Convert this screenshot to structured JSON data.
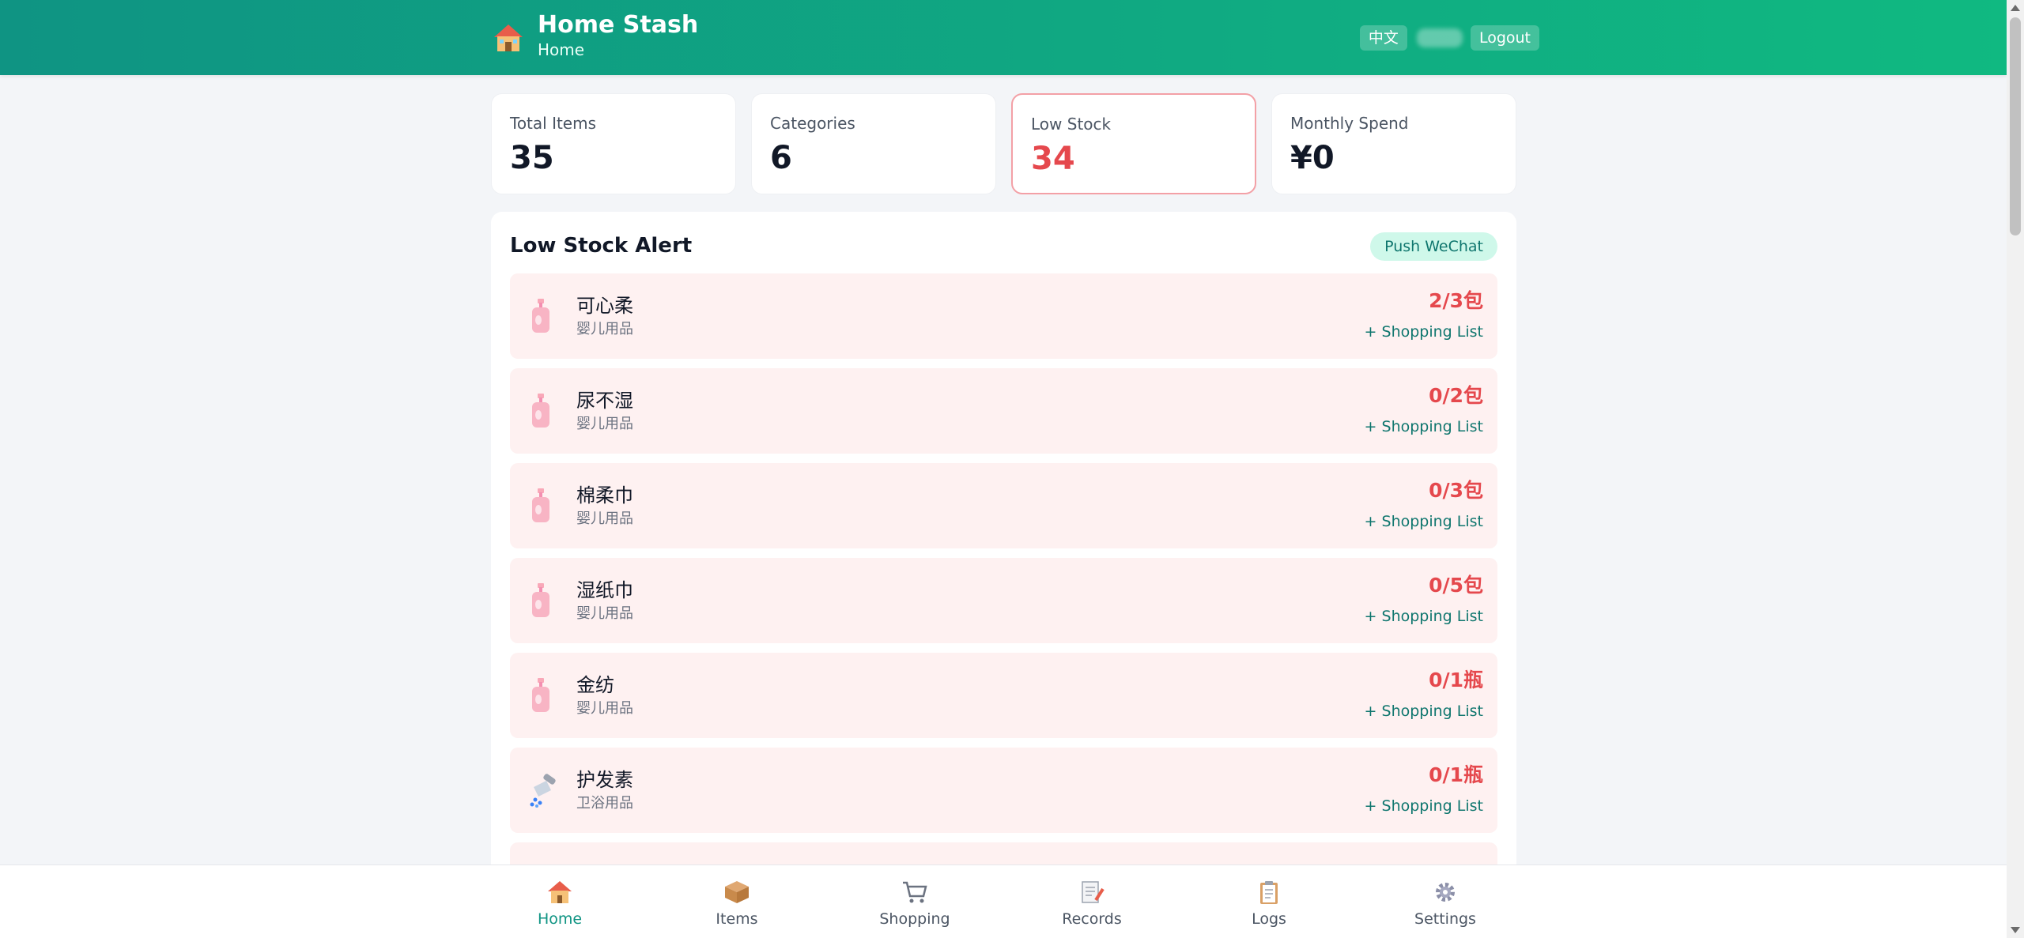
{
  "header": {
    "title": "Home Stash",
    "subtitle": "Home",
    "lang_label": "中文",
    "logout_label": "Logout"
  },
  "stats": [
    {
      "label": "Total Items",
      "value": "35"
    },
    {
      "label": "Categories",
      "value": "6"
    },
    {
      "label": "Low Stock",
      "value": "34"
    },
    {
      "label": "Monthly Spend",
      "value": "¥0"
    }
  ],
  "alert": {
    "title": "Low Stock Alert",
    "push_label": "Push WeChat",
    "items": [
      {
        "name": "可心柔",
        "category": "婴儿用品",
        "qty": "2/3包",
        "add": "+ Shopping List",
        "icon": "lotion-bottle-icon"
      },
      {
        "name": "尿不湿",
        "category": "婴儿用品",
        "qty": "0/2包",
        "add": "+ Shopping List",
        "icon": "lotion-bottle-icon"
      },
      {
        "name": "棉柔巾",
        "category": "婴儿用品",
        "qty": "0/3包",
        "add": "+ Shopping List",
        "icon": "lotion-bottle-icon"
      },
      {
        "name": "湿纸巾",
        "category": "婴儿用品",
        "qty": "0/5包",
        "add": "+ Shopping List",
        "icon": "lotion-bottle-icon"
      },
      {
        "name": "金纺",
        "category": "婴儿用品",
        "qty": "0/1瓶",
        "add": "+ Shopping List",
        "icon": "lotion-bottle-icon"
      },
      {
        "name": "护发素",
        "category": "卫浴用品",
        "qty": "0/1瓶",
        "add": "+ Shopping List",
        "icon": "shower-icon"
      }
    ]
  },
  "nav": [
    {
      "label": "Home",
      "icon": "house-icon",
      "active": true
    },
    {
      "label": "Items",
      "icon": "package-icon",
      "active": false
    },
    {
      "label": "Shopping",
      "icon": "cart-icon",
      "active": false
    },
    {
      "label": "Records",
      "icon": "memo-icon",
      "active": false
    },
    {
      "label": "Logs",
      "icon": "clipboard-icon",
      "active": false
    },
    {
      "label": "Settings",
      "icon": "gear-icon",
      "active": false
    }
  ],
  "colors": {
    "header_start": "#0f9483",
    "header_end": "#10b981",
    "alert_red": "#e5484d",
    "accent_teal": "#0f766e"
  }
}
